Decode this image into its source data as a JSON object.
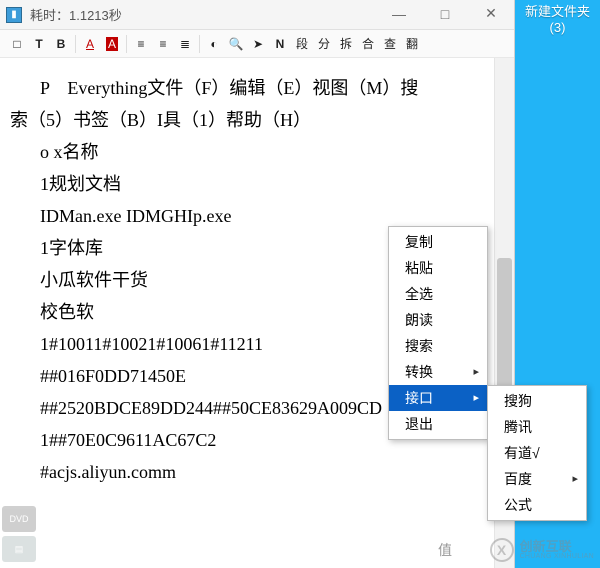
{
  "window": {
    "title": "耗时：1.1213秒",
    "controls": {
      "min": "—",
      "max": "□",
      "close": "✕"
    }
  },
  "toolbar": {
    "square": "□",
    "t": "T",
    "b": "B",
    "a_red": "A",
    "a_fill": "A",
    "lines": "≡",
    "left": "≡",
    "center": "≣",
    "glasses": "◐",
    "search": "🔍",
    "send": "➤",
    "n": "N",
    "paragraph": "段",
    "split": "分",
    "dismantle": "拆",
    "merge": "合",
    "lookup": "查",
    "translate": "翻"
  },
  "content_lines": [
    "P　Everything文件（F）编辑（E）视图（M）搜",
    "索（5）书签（B）I具（1）帮助（H）",
    "o x名称",
    "1规划文档",
    "IDMan.exe IDMGHIp.exe",
    "1字体库",
    "小瓜软件干货",
    "校色软",
    "1#10011#10021#10061#11211",
    "##016F0DD71450E",
    "##2520BDCE89DD244##50CE83629A009CD",
    "1##70E0C9611AC67C2",
    "#acjs.aliyun.comm"
  ],
  "context_menu_1": {
    "items": [
      "复制",
      "粘贴",
      "全选",
      "朗读",
      "搜索",
      "转换",
      "接口",
      "退出"
    ],
    "highlighted_index": 6,
    "submenu_indices": [
      5,
      6
    ]
  },
  "context_menu_2": {
    "items": [
      "搜狗",
      "腾讯",
      "有道√",
      "百度",
      "公式"
    ],
    "submenu_indices": [
      3
    ]
  },
  "desktop": {
    "folder_label_line1": "新建文件夹",
    "folder_label_line2": "(3)"
  },
  "watermark": {
    "cn": "创新互联",
    "en": "CHUANG XINHULIAN"
  },
  "bottom": {
    "value_label": "值",
    "dvd": "DVD"
  }
}
